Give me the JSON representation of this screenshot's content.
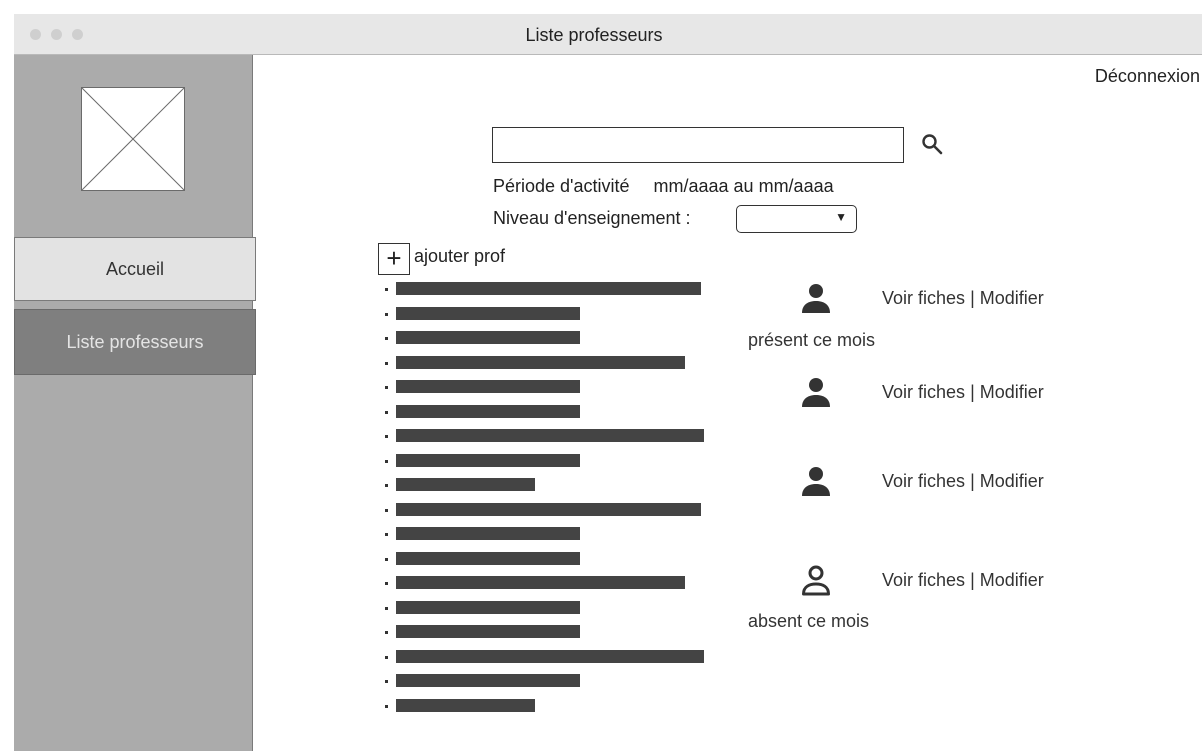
{
  "window": {
    "title": "Liste professeurs"
  },
  "sidebar": {
    "items": [
      {
        "label": "Accueil",
        "active": false
      },
      {
        "label": "Liste professeurs",
        "active": true
      }
    ]
  },
  "header": {
    "logout_label": "Déconnexion"
  },
  "search": {
    "value": "",
    "placeholder": ""
  },
  "filters": {
    "periode_label": "Période d'activité",
    "periode_value": "mm/aaaa au mm/aaaa",
    "niveau_label": "Niveau d'enseignement :",
    "niveau_selected": ""
  },
  "add_prof": {
    "icon": "plus-icon",
    "label": "ajouter prof"
  },
  "prof_list": {
    "count": 18
  },
  "cards": [
    {
      "icon": "user-filled-icon",
      "voir": "Voir fiches",
      "separator": "|",
      "modifier": "Modifier",
      "status": "présent ce mois"
    },
    {
      "icon": "user-filled-icon",
      "voir": "Voir fiches",
      "separator": "|",
      "modifier": "Modifier",
      "status": ""
    },
    {
      "icon": "user-filled-icon",
      "voir": "Voir fiches",
      "separator": "|",
      "modifier": "Modifier",
      "status": ""
    },
    {
      "icon": "user-outline-icon",
      "voir": "Voir fiches",
      "separator": "|",
      "modifier": "Modifier",
      "status": "absent ce mois"
    }
  ],
  "colors": {
    "sidebar": "#ababab",
    "active_nav": "#7f7f7f",
    "placeholder_bar": "#444444"
  }
}
